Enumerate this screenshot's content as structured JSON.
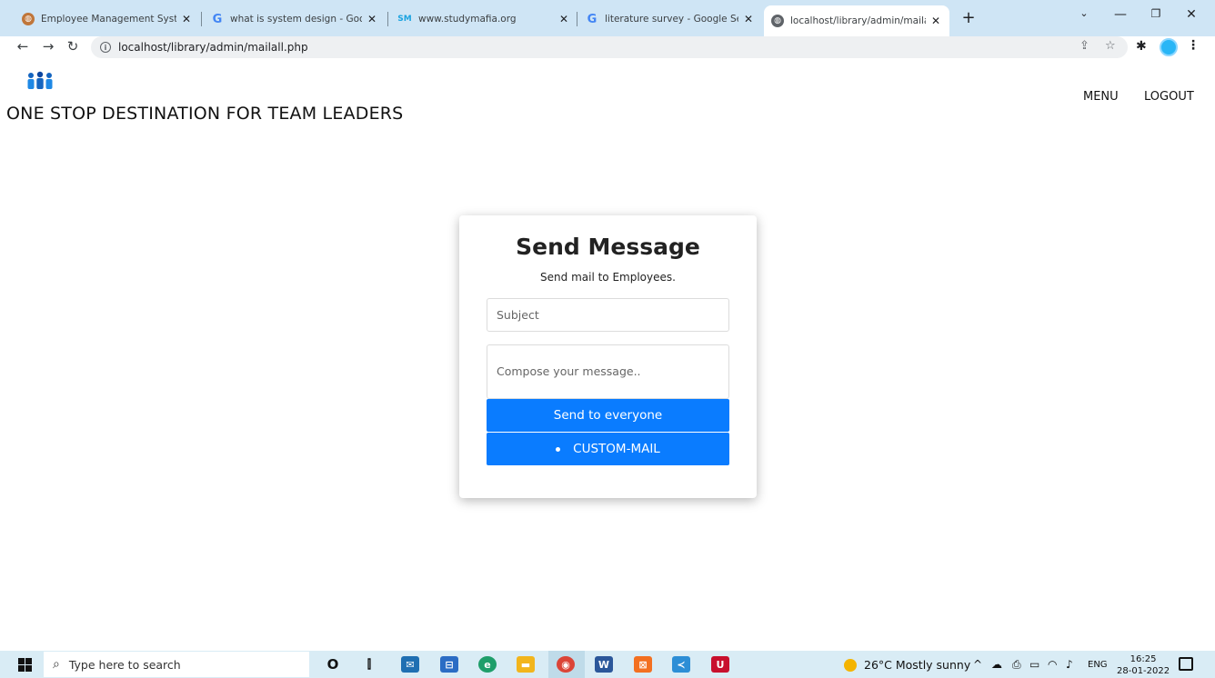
{
  "browser": {
    "tabs": [
      {
        "title": "Employee Management System",
        "favicon": "globe-icon",
        "active": false
      },
      {
        "title": "what is system design - Google S",
        "favicon": "google-icon",
        "active": false
      },
      {
        "title": "www.studymafia.org",
        "favicon": "sm-icon",
        "active": false
      },
      {
        "title": "literature survey - Google Search",
        "favicon": "google-icon",
        "active": false
      },
      {
        "title": "localhost/library/admin/mailall.p",
        "favicon": "globe-icon",
        "active": true
      }
    ],
    "address": "localhost/library/admin/mailall.php",
    "colors": {
      "tabstrip": "#cfe5f5",
      "omnibox": "#eef0f2"
    }
  },
  "header": {
    "site_title": "ONE STOP DESTINATION FOR TEAM LEADERS",
    "nav": {
      "menu": "MENU",
      "logout": "LOGOUT"
    },
    "logo_icon": "team-people-icon"
  },
  "card": {
    "title": "Send Message",
    "subtitle": "Send mail to Employees.",
    "subject_placeholder": "Subject",
    "message_placeholder": "Compose your message..",
    "send_all_label": "Send to everyone",
    "custom_mail_label": "CUSTOM-MAIL",
    "button_color": "#0a7cff"
  },
  "taskbar": {
    "search_placeholder": "Type here to search",
    "weather": "26°C  Mostly sunny",
    "language": "ENG",
    "time": "16:25",
    "date": "28-01-2022"
  }
}
